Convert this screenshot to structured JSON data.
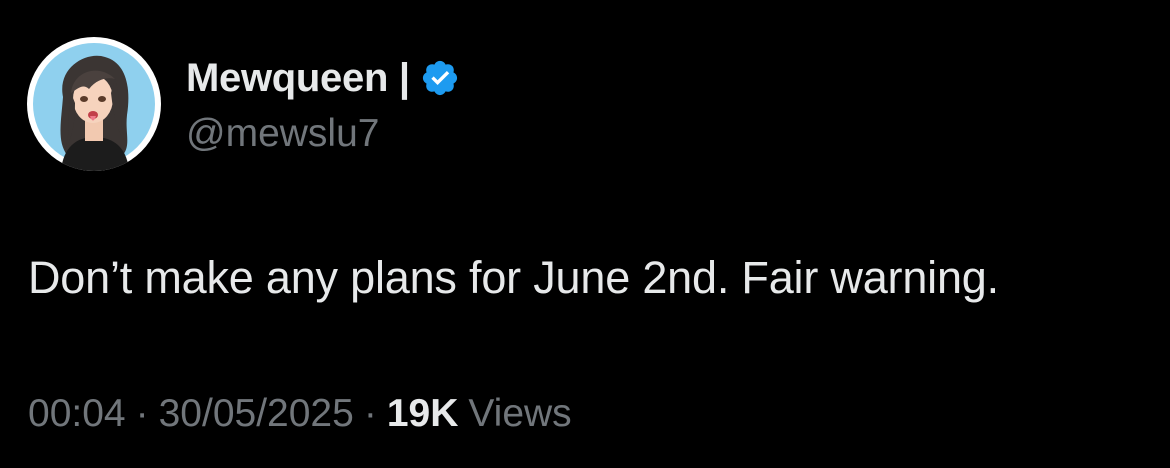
{
  "author": {
    "display_name": "Mewqueen |",
    "handle": "@mewslu7",
    "verified": true,
    "verified_color": "#1d9bf0",
    "avatar_icon": "cartoon-girl-avatar"
  },
  "tweet": {
    "text": "Don’t make any plans for June 2nd. Fair warning."
  },
  "meta": {
    "time": "00:04",
    "separator": "·",
    "date": "30/05/2025",
    "views_count": "19K",
    "views_label": "Views"
  },
  "colors": {
    "background": "#000000",
    "primary_text": "#e7e9ea",
    "secondary_text": "#71767b",
    "accent": "#1d9bf0"
  }
}
